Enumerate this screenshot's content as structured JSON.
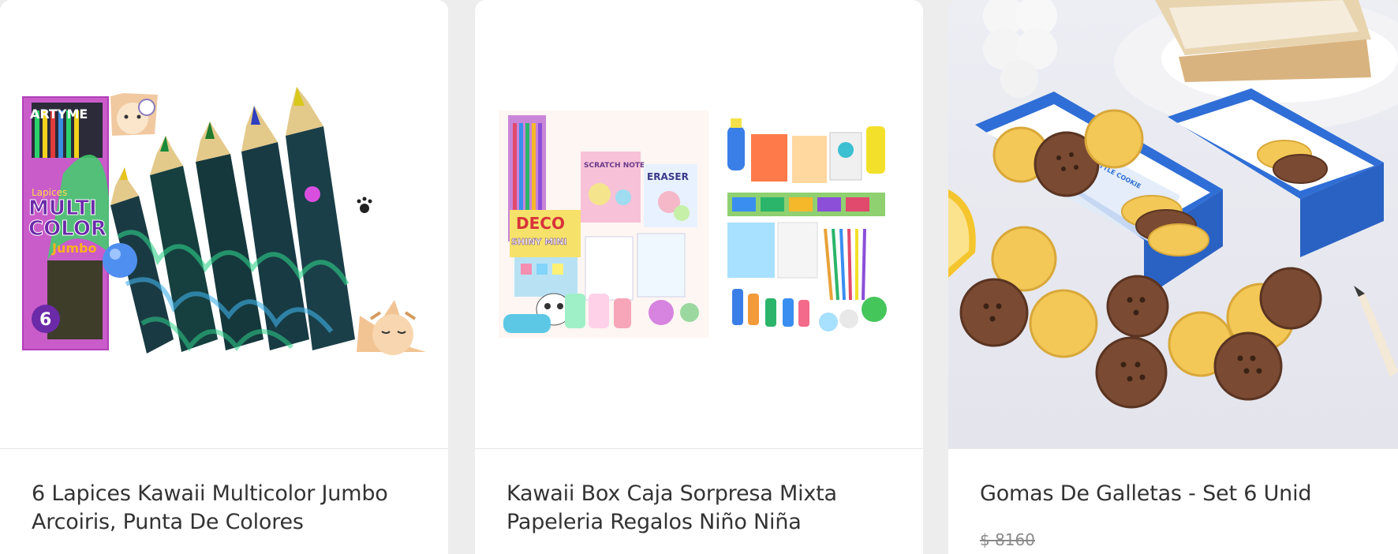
{
  "products": [
    {
      "title_line1": "6 Lapices Kawaii Multicolor Jumbo",
      "title_line2": "Arcoiris, Punta De Colores",
      "image_alt": "pencils-box-image",
      "package_brand": "ARTYME",
      "package_label_1": "Lapices",
      "package_label_2": "MULTI",
      "package_label_3": "COLOR",
      "package_label_4": "Jumbo",
      "package_count": "6"
    },
    {
      "title_line1": "Kawaii Box Caja Sorpresa Mixta",
      "title_line2": "Papeleria Regalos Niño Niña",
      "image_alt": "kawaii-box-image",
      "item_label_1": "SCRATCH NOTE",
      "item_label_2": "ERASER",
      "item_label_3": "DECO",
      "item_label_4": "SHINY MINI"
    },
    {
      "title_line1": "Gomas De Galletas - Set 6 Unid",
      "old_price": "$ 8160",
      "image_alt": "cookie-erasers-image",
      "box_label": "ERASER LITTLE COOKIE"
    }
  ],
  "colors": {
    "page_bg": "#ededed",
    "card_bg": "#ffffff",
    "title_text": "#333333",
    "old_price_text": "#8a8a8a"
  }
}
